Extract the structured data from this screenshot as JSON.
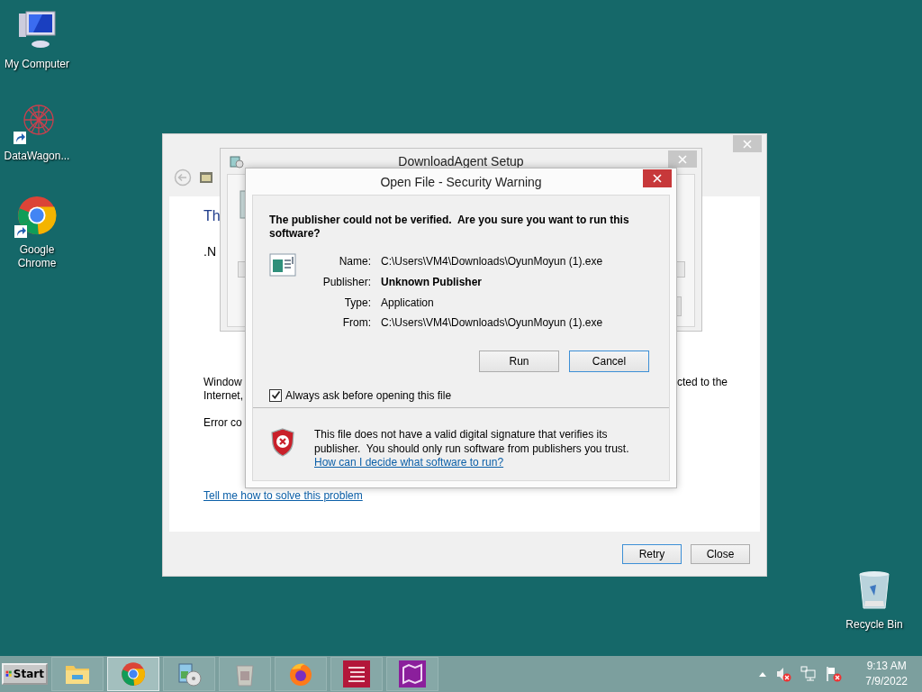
{
  "desktop_icons": [
    {
      "label": "My Computer",
      "kind": "computer",
      "shortcut": false
    },
    {
      "label": "DataWagon...",
      "kind": "web",
      "shortcut": true
    },
    {
      "label": "Google Chrome",
      "kind": "chrome",
      "shortcut": true
    },
    {
      "label": "Recycle Bin",
      "kind": "bin",
      "shortcut": false
    }
  ],
  "back_window": {
    "texts": [
      {
        "kind": "heading",
        "text": "Th"
      },
      {
        "kind": "line",
        "text": ".N"
      }
    ],
    "message_left": [
      "Window",
      "Internet,"
    ],
    "message_right": "cted to the",
    "error": "Error co",
    "link": "Tell me how to solve this problem",
    "buttons": [
      {
        "label": "Retry",
        "default": true
      },
      {
        "label": "Close",
        "default": false
      }
    ]
  },
  "setup_window": {
    "title": "DownloadAgent Setup"
  },
  "dialog": {
    "title": "Open File - Security Warning",
    "heading": "The publisher could not be verified.  Are you sure you want to run this software?",
    "fields": [
      {
        "label": "Name:",
        "value": "C:\\Users\\VM4\\Downloads\\OyunMoyun (1).exe",
        "bold": false
      },
      {
        "label": "Publisher:",
        "value": "Unknown Publisher",
        "bold": true
      },
      {
        "label": "Type:",
        "value": "Application",
        "bold": false
      },
      {
        "label": "From:",
        "value": "C:\\Users\\VM4\\Downloads\\OyunMoyun (1).exe",
        "bold": false
      }
    ],
    "buttons": [
      {
        "label": "Run",
        "default": false
      },
      {
        "label": "Cancel",
        "default": true
      }
    ],
    "always_ask": {
      "label": "Always ask before opening this file",
      "checked": true
    },
    "warning": "This file does not have a valid digital signature that verifies its publisher.  You should only run software from publishers you trust.",
    "help_link": "How can I decide what software to run?"
  },
  "taskbar": {
    "start": "Start",
    "apps": [
      {
        "kind": "folder",
        "selected": false
      },
      {
        "kind": "chrome",
        "selected": true
      },
      {
        "kind": "installer",
        "selected": false
      },
      {
        "kind": "package",
        "selected": false
      },
      {
        "kind": "firefox",
        "selected": false
      },
      {
        "kind": "red-app",
        "selected": false
      },
      {
        "kind": "purple-app",
        "selected": false
      }
    ],
    "time": "9:13 AM",
    "date": "7/9/2022"
  }
}
